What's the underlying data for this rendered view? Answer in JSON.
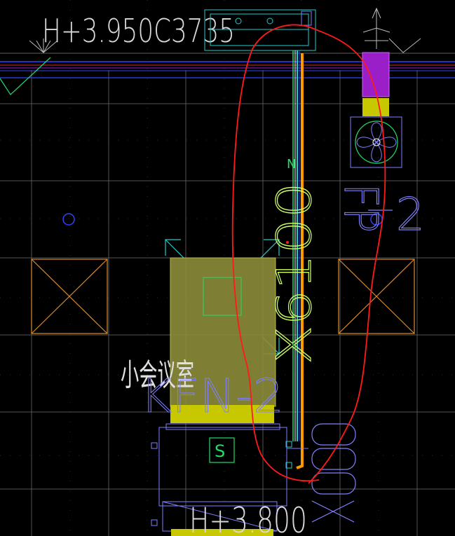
{
  "drawing": {
    "background": "#000000",
    "labels": {
      "top_elevation": "H+3.950C3735",
      "bottom_elevation": "H+3.800",
      "room_name": "小会议室",
      "room_code": "KFN-2",
      "right_tag": "FP-2",
      "fixture_code": "X6100",
      "marker_n": "N",
      "marker_s": "S"
    },
    "colors": {
      "grid": "#5a5a5a",
      "dim_grid": "#2a2a2a",
      "text": "#d9d9d9",
      "red_markup": "#ff1a1a",
      "yellow_fill": "#c8c800",
      "olive_fill": "#8c8c3a",
      "purple_fill": "#9b1fc8",
      "orange_line": "#ff9900",
      "green_line": "#22dd66",
      "cyan_line": "#22cccc",
      "lavender": "#8080ff",
      "lime_text": "#ccff66",
      "blue_line": "#3040ff"
    }
  }
}
